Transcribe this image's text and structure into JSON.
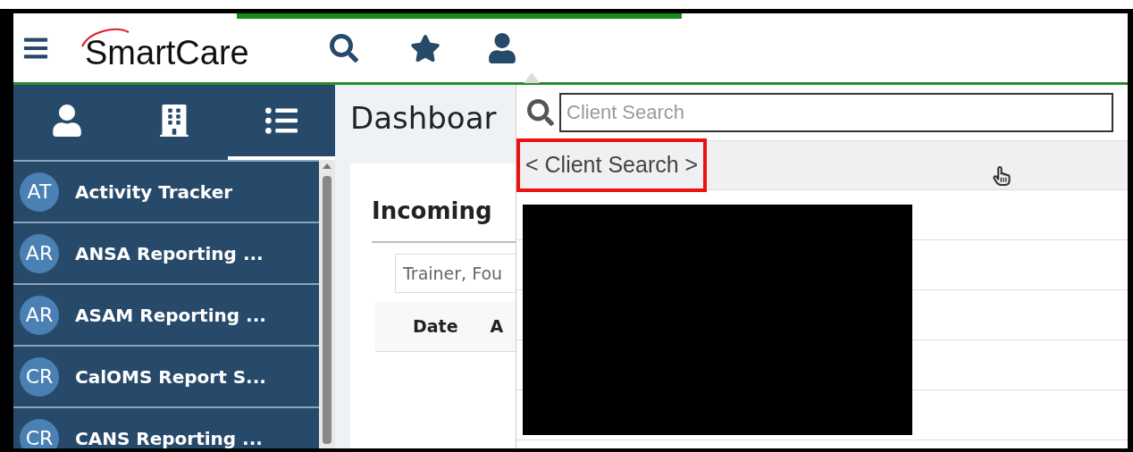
{
  "header": {
    "logo": "SmartCare"
  },
  "sidebar": {
    "tabs": [
      {
        "kind": "person",
        "selected": false
      },
      {
        "kind": "building",
        "selected": false
      },
      {
        "kind": "list",
        "selected": true
      }
    ],
    "items": [
      {
        "initials": "AT",
        "label": "Activity Tracker"
      },
      {
        "initials": "AR",
        "label": "ANSA Reporting ..."
      },
      {
        "initials": "AR",
        "label": "ASAM Reporting ..."
      },
      {
        "initials": "CR",
        "label": "CalOMS Report S..."
      },
      {
        "initials": "CR",
        "label": "CANS Reporting ..."
      }
    ]
  },
  "main": {
    "title": "Dashboar",
    "card": {
      "title": "Incoming",
      "filter": "Trainer, Fou",
      "columns": [
        "Date",
        "A"
      ]
    }
  },
  "client_search": {
    "placeholder": "Client Search",
    "result": "< Client Search >"
  }
}
